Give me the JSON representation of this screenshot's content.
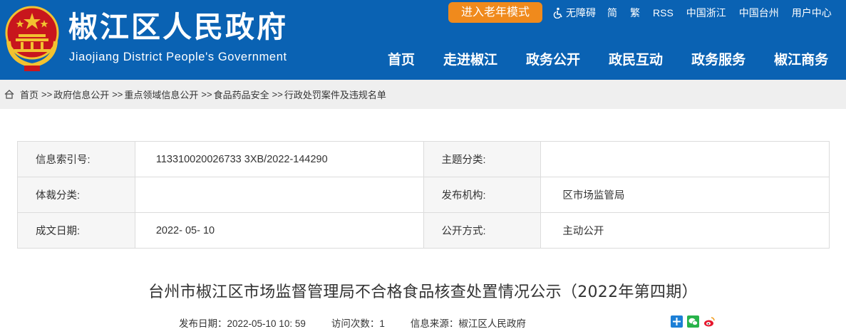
{
  "header": {
    "title": "椒江区人民政府",
    "subtitle": "Jiaojiang District People's Government",
    "elder_mode_label": "进入老年模式",
    "top_links": {
      "accessibility": "无障碍",
      "simplified": "简",
      "traditional": "繁",
      "rss": "RSS",
      "zhejiang": "中国浙江",
      "taizhou": "中国台州",
      "user_center": "用户中心"
    },
    "nav": [
      "首页",
      "走进椒江",
      "政务公开",
      "政民互动",
      "政务服务",
      "椒江商务"
    ]
  },
  "breadcrumb": {
    "items": [
      "首页",
      "政府信息公开",
      "重点领域信息公开",
      "食品药品安全",
      "行政处罚案件及违规名单"
    ],
    "separator": ">>"
  },
  "info": {
    "index_label": "信息索引号:",
    "index_value": "113310020026733 3XB/2022-144290",
    "topic_label": "主题分类:",
    "topic_value": "",
    "genre_label": "体裁分类:",
    "genre_value": "",
    "org_label": "发布机构:",
    "org_value": "区市场监管局",
    "date_label": "成文日期:",
    "date_value": "2022- 05- 10",
    "open_label": "公开方式:",
    "open_value": "主动公开"
  },
  "article": {
    "title": "台州市椒江区市场监督管理局不合格食品核查处置情况公示（2022年第四期）",
    "publish_label": "发布日期：",
    "publish_value": "2022-05-10 10: 59",
    "visits_label": "访问次数：",
    "visits_value": "1",
    "source_label": "信息来源：",
    "source_value": "椒江区人民政府"
  },
  "share": [
    "share-plus-icon",
    "wechat-icon",
    "weibo-icon"
  ],
  "colors": {
    "header_bg": "#0a62b3",
    "elder_button": "#f08a1c",
    "breadcrumb_bg": "#efefef",
    "label_cell_bg": "#f6f6f6"
  }
}
